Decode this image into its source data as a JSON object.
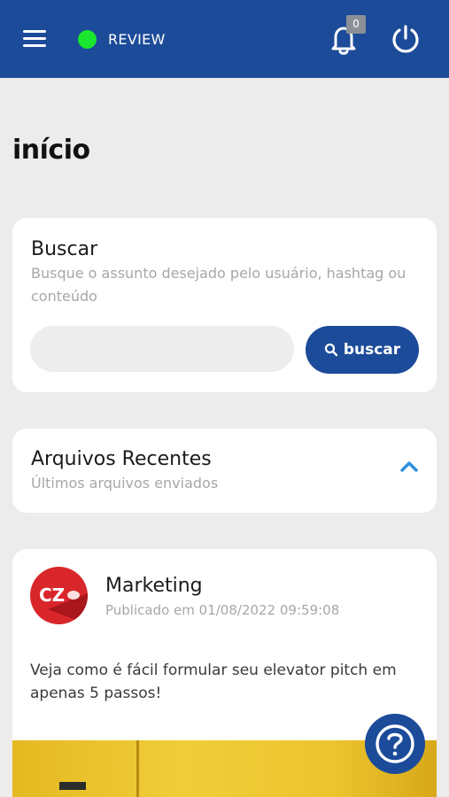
{
  "header": {
    "status_label": "REVIEW",
    "notification_count": "0",
    "status_color": "#19e62c",
    "brand_color": "#1c4b99"
  },
  "page": {
    "title": "início"
  },
  "search": {
    "title": "Buscar",
    "subtitle": "Busque o assunto desejado pelo usuário, hashtag ou conteúdo",
    "input_value": "",
    "placeholder": "",
    "button_label": "buscar"
  },
  "recent_files": {
    "title": "Arquivos Recentes",
    "subtitle": "Últimos arquivos enviados"
  },
  "post": {
    "avatar_text": "CZ",
    "author": "Marketing",
    "date": "Publicado em 01/08/2022 09:59:08",
    "text": "Veja como é fácil formular seu elevator pitch em apenas 5 passos!"
  },
  "icons": [
    "menu-icon",
    "bell-icon",
    "power-icon",
    "search-icon",
    "chevron-up-icon",
    "help-icon"
  ]
}
